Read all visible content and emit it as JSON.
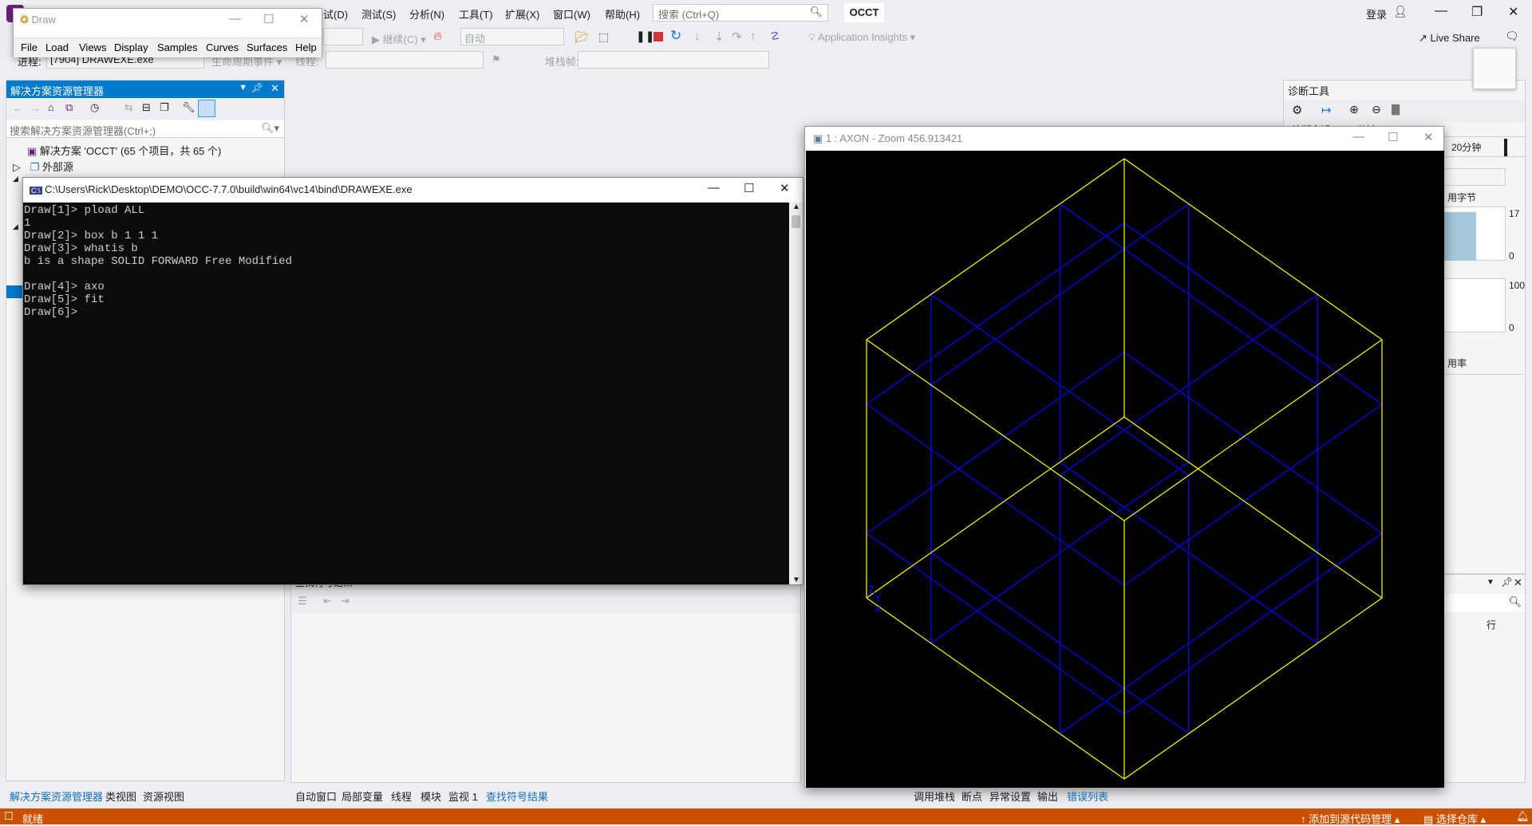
{
  "vs": {
    "menus": [
      "试(D)",
      "测试(S)",
      "分析(N)",
      "工具(T)",
      "扩展(X)",
      "窗口(W)",
      "帮助(H)"
    ],
    "search_placeholder": "搜索 (Ctrl+Q)",
    "project": "OCCT",
    "login": "登录",
    "live_share": "Live Share",
    "toolbar": {
      "continue": "继续(C)",
      "auto": "自动",
      "app_insights": "Application Insights",
      "process_label": "进程:",
      "process_value": "[7904] DRAWEXE.exe",
      "lifecycle": "生命周期事件",
      "thread_label": "线程:",
      "stack_frame": "堆栈帧:"
    }
  },
  "draw_window": {
    "title": "Draw",
    "menu": [
      "File",
      "Load",
      "Views",
      "Display",
      "Samples",
      "Curves",
      "Surfaces",
      "Help"
    ]
  },
  "solution_explorer": {
    "title": "解决方案资源管理器",
    "search_placeholder": "搜索解决方案资源管理器(Ctrl+;)",
    "items": [
      {
        "label": "解决方案 'OCCT' (65 个项目，共 65 个)"
      },
      {
        "label": "外部源"
      }
    ]
  },
  "console": {
    "title": "C:\\Users\\Rick\\Desktop\\DEMO\\OCC-7.7.0\\build\\win64\\vc14\\bind\\DRAWEXE.exe",
    "lines": [
      "Draw[1]> pload ALL",
      "1",
      "Draw[2]> box b 1 1 1",
      "Draw[3]> whatis b",
      "b is a shape SOLID FORWARD Free Modified",
      "",
      "Draw[4]> axo",
      "Draw[5]> fit",
      "Draw[6]>"
    ]
  },
  "axon_window": {
    "title": "1 : AXON - Zoom 456.913421",
    "axis_labels": [
      "Z",
      "Y",
      "X"
    ],
    "colors": {
      "edges": "#ffff00",
      "isos": "#0000ff",
      "background": "#000000"
    }
  },
  "diagnostics": {
    "title": "诊断工具",
    "session": "诊断会话: 2:24 分钟",
    "timeline": "20分钟",
    "memory_label": "用字节",
    "memory_max": "17",
    "memory_min": "0",
    "cpu_max": "100",
    "cpu_min": "0",
    "cpu_label": "用率"
  },
  "find_symbol": {
    "title": "查找符号结果",
    "row_header": "行"
  },
  "bottom_tabs_left": [
    {
      "label": "解决方案资源管理器",
      "active": true
    },
    {
      "label": "类视图",
      "active": false
    },
    {
      "label": "资源视图",
      "active": false
    }
  ],
  "bottom_tabs_mid": [
    {
      "label": "自动窗口",
      "active": false
    },
    {
      "label": "局部变量",
      "active": false
    },
    {
      "label": "线程",
      "active": false
    },
    {
      "label": "模块",
      "active": false
    },
    {
      "label": "监视 1",
      "active": false
    },
    {
      "label": "查找符号结果",
      "active": true
    }
  ],
  "bottom_tabs_right": [
    {
      "label": "调用堆栈",
      "active": false
    },
    {
      "label": "断点",
      "active": false
    },
    {
      "label": "异常设置",
      "active": false
    },
    {
      "label": "输出",
      "active": false
    },
    {
      "label": "错误列表",
      "active": true
    }
  ],
  "status_bar": {
    "ready": "就绪",
    "add_source_control": "添加到源代码管理",
    "select_repo": "选择仓库"
  }
}
